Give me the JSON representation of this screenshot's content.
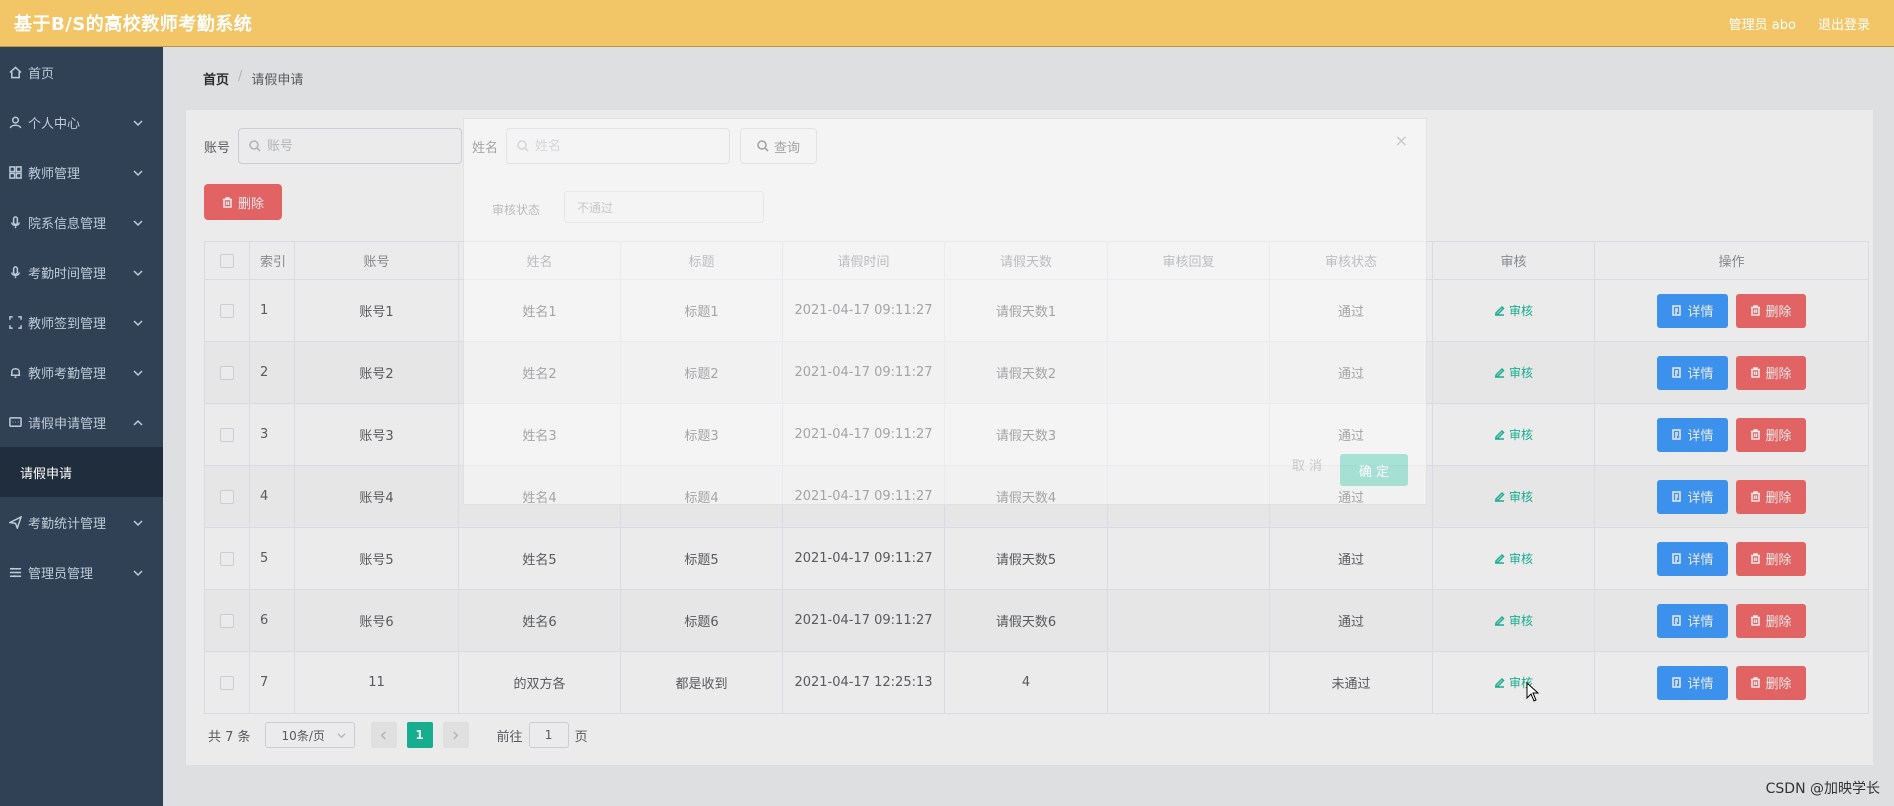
{
  "header": {
    "title": "基于B/S的高校教师考勤系统",
    "admin_label": "管理员 abo",
    "logout_label": "退出登录",
    "bg_color": "#f2c566"
  },
  "sidebar": {
    "items": [
      {
        "label": "首页",
        "icon": "home-icon"
      },
      {
        "label": "个人中心",
        "icon": "user-icon"
      },
      {
        "label": "教师管理",
        "icon": "grid-icon"
      },
      {
        "label": "院系信息管理",
        "icon": "mic-icon"
      },
      {
        "label": "考勤时间管理",
        "icon": "mic-icon"
      },
      {
        "label": "教师签到管理",
        "icon": "fullscreen-icon"
      },
      {
        "label": "教师考勤管理",
        "icon": "bell-icon"
      },
      {
        "label": "请假申请管理",
        "icon": "chat-icon"
      },
      {
        "label": "考勤统计管理",
        "icon": "send-icon"
      },
      {
        "label": "管理员管理",
        "icon": "sliders-icon"
      }
    ],
    "sub_item": "请假申请"
  },
  "breadcrumb": {
    "home": "首页",
    "sep": "/",
    "current": "请假申请"
  },
  "search": {
    "account_label": "账号",
    "account_placeholder": "账号",
    "name_label": "姓名",
    "name_placeholder": "姓名",
    "query_label": "查询"
  },
  "delete_label": "删除",
  "table": {
    "headers": [
      "索引",
      "账号",
      "姓名",
      "标题",
      "请假时间",
      "请假天数",
      "审核回复",
      "审核状态",
      "审核",
      "操作"
    ],
    "audit_label": "审核",
    "detail_label": "详情",
    "delete_label": "删除",
    "rows": [
      {
        "idx": "1",
        "account": "账号1",
        "name": "姓名1",
        "title": "标题1",
        "time": "2021-04-17 09:11:27",
        "days": "请假天数1",
        "reply": "",
        "status": "通过"
      },
      {
        "idx": "2",
        "account": "账号2",
        "name": "姓名2",
        "title": "标题2",
        "time": "2021-04-17 09:11:27",
        "days": "请假天数2",
        "reply": "",
        "status": "通过"
      },
      {
        "idx": "3",
        "account": "账号3",
        "name": "姓名3",
        "title": "标题3",
        "time": "2021-04-17 09:11:27",
        "days": "请假天数3",
        "reply": "",
        "status": "通过"
      },
      {
        "idx": "4",
        "account": "账号4",
        "name": "姓名4",
        "title": "标题4",
        "time": "2021-04-17 09:11:27",
        "days": "请假天数4",
        "reply": "",
        "status": "通过"
      },
      {
        "idx": "5",
        "account": "账号5",
        "name": "姓名5",
        "title": "标题5",
        "time": "2021-04-17 09:11:27",
        "days": "请假天数5",
        "reply": "",
        "status": "通过"
      },
      {
        "idx": "6",
        "account": "账号6",
        "name": "姓名6",
        "title": "标题6",
        "time": "2021-04-17 09:11:27",
        "days": "请假天数6",
        "reply": "",
        "status": "通过"
      },
      {
        "idx": "7",
        "account": "11",
        "name": "的双方各",
        "title": "都是收到",
        "time": "2021-04-17 12:25:13",
        "days": "4",
        "reply": "",
        "status": "未通过"
      }
    ]
  },
  "pagination": {
    "total": "共 7 条",
    "page_size": "10条/页",
    "current_page": "1",
    "goto_label": "前往",
    "goto_value": "1",
    "page_unit": "页"
  },
  "dialog": {
    "close": "×",
    "field_label": "审核状态",
    "field_value": "不通过",
    "cancel_label": "取 消",
    "ok_label": "确 定"
  },
  "watermark": "CSDN @加映学长",
  "colors": {
    "accent": "#1abc9c",
    "blue": "#409eff",
    "red": "#f56c6c",
    "sidebar": "#304156"
  }
}
